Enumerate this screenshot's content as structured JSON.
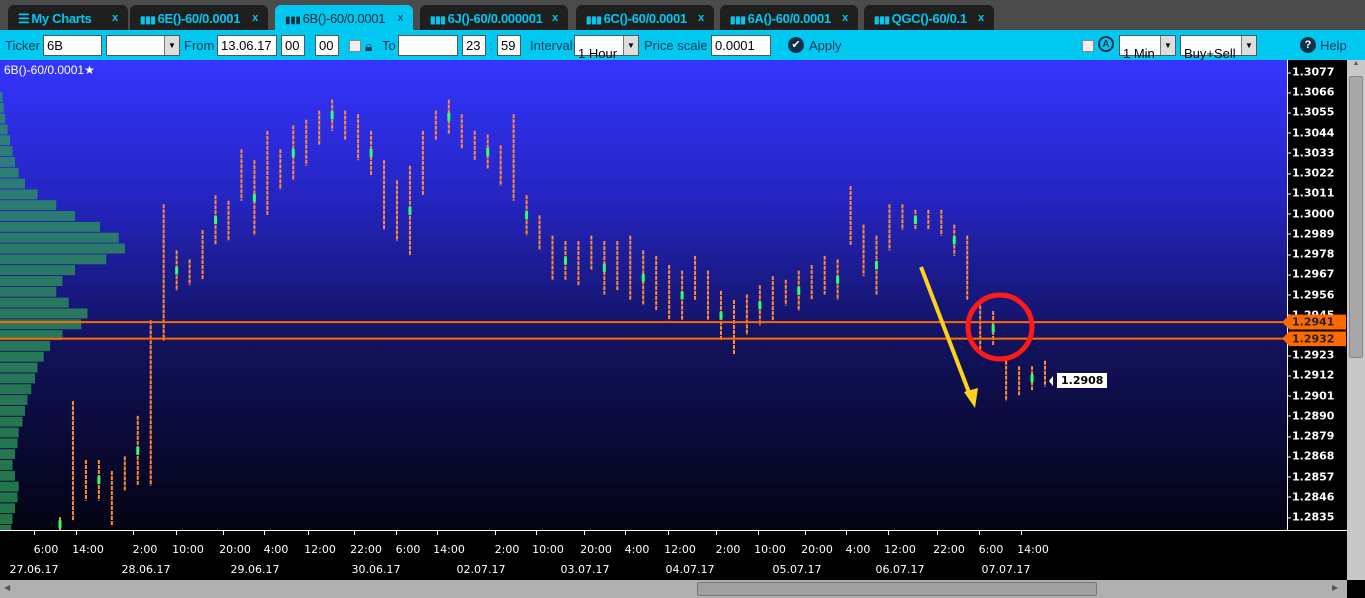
{
  "tabs": [
    {
      "label": "My Charts",
      "icon": "menu-icon"
    },
    {
      "label": "6E()-60/0.0001",
      "icon": "bar-chart-icon"
    },
    {
      "label": "6B()-60/0.0001",
      "icon": "bar-chart-icon",
      "active": true
    },
    {
      "label": "6J()-60/0.000001",
      "icon": "bar-chart-icon"
    },
    {
      "label": "6C()-60/0.0001",
      "icon": "bar-chart-icon"
    },
    {
      "label": "6A()-60/0.0001",
      "icon": "bar-chart-icon"
    },
    {
      "label": "QGC()-60/0.1",
      "icon": "bar-chart-icon"
    }
  ],
  "tab_close": "x",
  "toolbar": {
    "ticker_label": "Ticker",
    "ticker_value": "6B",
    "ticker_select": "",
    "from_label": "From",
    "from_date": "13.06.17",
    "from_hour": "00",
    "from_min": "00",
    "to_label": "To",
    "to_date": "",
    "to_hour": "23",
    "to_min": "59",
    "colon": ":",
    "interval_label": "Interval",
    "interval_value": "1 Hour",
    "price_scale_label": "Price scale",
    "price_scale_value": "0.0001",
    "apply_label": "Apply",
    "timeframe_value": "1 Min",
    "side_value": "Buy+Sell",
    "help_label": "Help"
  },
  "chart": {
    "title": "6B()-60/0.0001",
    "price_ticks": [
      "1.3077",
      "1.3066",
      "1.3055",
      "1.3044",
      "1.3033",
      "1.3022",
      "1.3011",
      "1.3000",
      "1.2989",
      "1.2978",
      "1.2967",
      "1.2956",
      "1.2945",
      "1.2923",
      "1.2912",
      "1.2901",
      "1.2890",
      "1.2879",
      "1.2868",
      "1.2857",
      "1.2846",
      "1.2835"
    ],
    "levels": [
      "1.2941",
      "1.2932"
    ],
    "last_price": "1.2908",
    "time_labels": [
      "6:00",
      "14:00",
      "2:00",
      "10:00",
      "20:00",
      "4:00",
      "12:00",
      "22:00",
      "6:00",
      "14:00",
      "2:00",
      "10:00",
      "20:00",
      "4:00",
      "12:00",
      "2:00",
      "10:00",
      "20:00",
      "4:00",
      "12:00",
      "22:00",
      "6:00",
      "14:00"
    ],
    "date_labels": [
      "27.06.17",
      "28.06.17",
      "29.06.17",
      "30.06.17",
      "02.07.17",
      "03.07.17",
      "04.07.17",
      "05.07.17",
      "06.07.17",
      "07.07.17"
    ],
    "colors": {
      "bar": "#ff8c3a",
      "up": "#33ff66",
      "level": "#ff6a00",
      "circle": "#ff1a1a",
      "arrow": "#ffd21a"
    }
  },
  "chart_data": {
    "type": "bar",
    "ylim": [
      1.283,
      1.308
    ],
    "bars": [
      [
        1.2835,
        1.2827
      ],
      [
        1.2898,
        1.2833
      ],
      [
        1.2866,
        1.2844
      ],
      [
        1.2866,
        1.2844
      ],
      [
        1.286,
        1.283
      ],
      [
        1.2868,
        1.2849
      ],
      [
        1.289,
        1.2852
      ],
      [
        1.2942,
        1.2852
      ],
      [
        1.3005,
        1.2931
      ],
      [
        1.298,
        1.2958
      ],
      [
        1.2975,
        1.2961
      ],
      [
        1.2991,
        1.2964
      ],
      [
        1.301,
        1.2983
      ],
      [
        1.3007,
        1.2985
      ],
      [
        1.3035,
        1.3007
      ],
      [
        1.3029,
        1.2988
      ],
      [
        1.3045,
        1.2999
      ],
      [
        1.3035,
        1.3013
      ],
      [
        1.3048,
        1.3018
      ],
      [
        1.3051,
        1.3026
      ],
      [
        1.3056,
        1.3037
      ],
      [
        1.3062,
        1.3045
      ],
      [
        1.3056,
        1.304
      ],
      [
        1.3054,
        1.3029
      ],
      [
        1.3045,
        1.3021
      ],
      [
        1.3029,
        1.2991
      ],
      [
        1.3018,
        1.2985
      ],
      [
        1.3026,
        1.2977
      ],
      [
        1.3045,
        1.301
      ],
      [
        1.3056,
        1.304
      ],
      [
        1.3062,
        1.3043
      ],
      [
        1.3054,
        1.3035
      ],
      [
        1.3045,
        1.3029
      ],
      [
        1.3043,
        1.3024
      ],
      [
        1.3037,
        1.3015
      ],
      [
        1.3054,
        1.3007
      ],
      [
        1.301,
        1.2988
      ],
      [
        1.2999,
        1.298
      ],
      [
        1.2988,
        1.2964
      ],
      [
        1.2985,
        1.2964
      ],
      [
        1.2985,
        1.2961
      ],
      [
        1.2988,
        1.2969
      ],
      [
        1.2985,
        1.2956
      ],
      [
        1.2985,
        1.2958
      ],
      [
        1.2988,
        1.2953
      ],
      [
        1.298,
        1.295
      ],
      [
        1.2977,
        1.2947
      ],
      [
        1.2972,
        1.2942
      ],
      [
        1.2969,
        1.2942
      ],
      [
        1.2977,
        1.2953
      ],
      [
        1.2969,
        1.2942
      ],
      [
        1.2958,
        1.2931
      ],
      [
        1.2953,
        1.2923
      ],
      [
        1.2956,
        1.2934
      ],
      [
        1.2961,
        1.2939
      ],
      [
        1.2966,
        1.2942
      ],
      [
        1.2964,
        1.295
      ],
      [
        1.2969,
        1.2947
      ],
      [
        1.2972,
        1.2953
      ],
      [
        1.2977,
        1.2956
      ],
      [
        1.2975,
        1.2953
      ],
      [
        1.3015,
        1.2983
      ],
      [
        1.2994,
        1.2966
      ],
      [
        1.2988,
        1.2956
      ],
      [
        1.3005,
        1.298
      ],
      [
        1.3005,
        1.2991
      ],
      [
        1.3002,
        1.2991
      ],
      [
        1.3002,
        1.2991
      ],
      [
        1.3002,
        1.2988
      ],
      [
        1.2994,
        1.2977
      ],
      [
        1.2988,
        1.2953
      ],
      [
        1.295,
        1.2923
      ],
      [
        1.2947,
        1.2928
      ],
      [
        1.292,
        1.2898
      ],
      [
        1.2917,
        1.2901
      ],
      [
        1.2917,
        1.2904
      ],
      [
        1.292,
        1.2906
      ]
    ],
    "volume_profile": [
      2,
      3,
      4,
      6,
      8,
      10,
      12,
      15,
      20,
      30,
      45,
      60,
      80,
      95,
      100,
      85,
      60,
      50,
      45,
      55,
      70,
      65,
      50,
      40,
      35,
      30,
      28,
      25,
      22,
      20,
      18,
      15,
      14,
      12,
      10,
      12,
      15,
      14,
      12,
      10,
      9,
      8,
      8,
      7,
      6
    ]
  }
}
